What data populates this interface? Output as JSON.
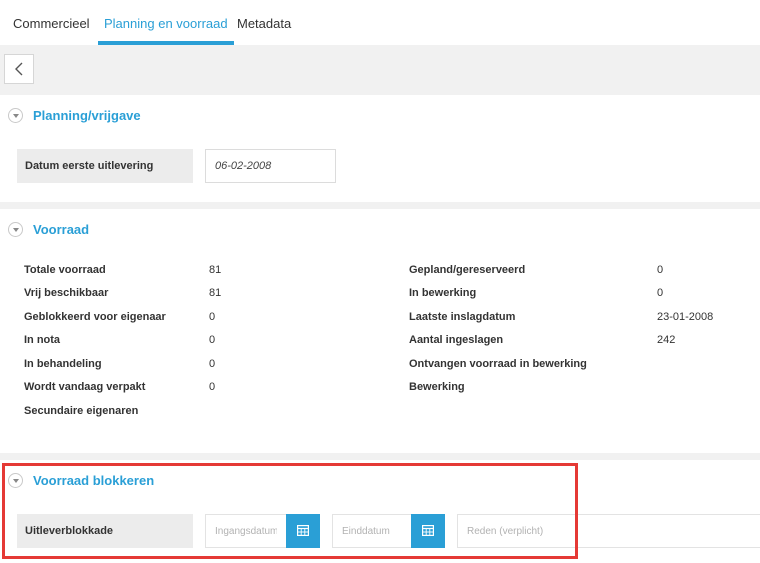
{
  "tabs": [
    {
      "label": "Commercieel",
      "active": false
    },
    {
      "label": "Planning en voorraad",
      "active": true
    },
    {
      "label": "Metadata",
      "active": false
    }
  ],
  "toolbar": {
    "back_icon": "chevron-left-icon"
  },
  "planning": {
    "title": "Planning/vrijgave",
    "field_label": "Datum eerste uitlevering",
    "field_value": "06-02-2008"
  },
  "voorraad": {
    "title": "Voorraad",
    "left": [
      {
        "label": "Totale voorraad",
        "value": "81"
      },
      {
        "label": "Vrij beschikbaar",
        "value": "81"
      },
      {
        "label": "Geblokkeerd voor eigenaar",
        "value": "0"
      },
      {
        "label": "In nota",
        "value": "0"
      },
      {
        "label": "In behandeling",
        "value": "0"
      },
      {
        "label": "Wordt vandaag verpakt",
        "value": "0"
      },
      {
        "label": "Secundaire eigenaren",
        "value": ""
      }
    ],
    "right": [
      {
        "label": "Gepland/gereserveerd",
        "value": "0"
      },
      {
        "label": "In bewerking",
        "value": "0"
      },
      {
        "label": "Laatste inslagdatum",
        "value": "23-01-2008"
      },
      {
        "label": "Aantal ingeslagen",
        "value": "242"
      },
      {
        "label": "Ontvangen voorraad in bewerking",
        "value": ""
      },
      {
        "label": "Bewerking",
        "value": ""
      }
    ]
  },
  "blokkeren": {
    "title": "Voorraad blokkeren",
    "field_label": "Uitleverblokkade",
    "start_placeholder": "Ingangsdatum",
    "end_placeholder": "Einddatum",
    "reason_placeholder": "Reden (verplicht)"
  },
  "colors": {
    "accent": "#2a9fd6",
    "highlight": "#e53935"
  }
}
